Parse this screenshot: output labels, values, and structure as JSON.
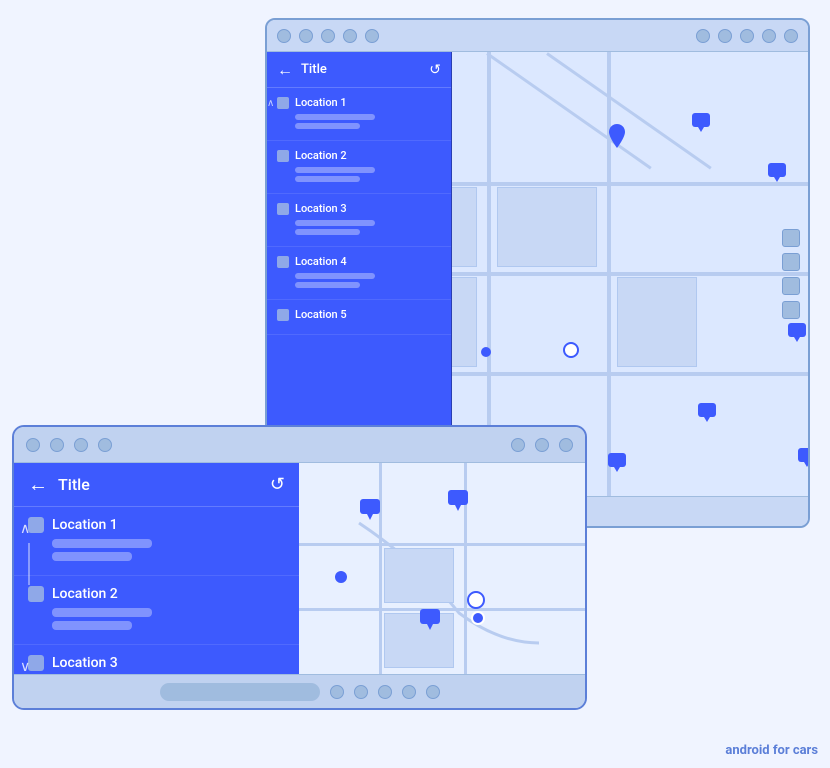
{
  "backScreen": {
    "title": "Title",
    "locations": [
      {
        "name": "Location 1",
        "bars": [
          100,
          65
        ]
      },
      {
        "name": "Location 2",
        "bars": [
          90,
          72
        ]
      },
      {
        "name": "Location 3",
        "bars": [
          85,
          60
        ]
      },
      {
        "name": "Location 4",
        "bars": [
          78,
          55
        ]
      },
      {
        "name": "Location 5",
        "bars": [
          70,
          50
        ]
      }
    ],
    "expandedItem": 0
  },
  "frontScreen": {
    "title": "Title",
    "locations": [
      {
        "name": "Location 1",
        "bars": [
          160,
          100
        ],
        "expanded": true
      },
      {
        "name": "Location 2",
        "bars": [
          160,
          100
        ],
        "expanded": false
      },
      {
        "name": "Location 3",
        "bars": [
          160,
          100
        ],
        "expanded": false
      }
    ]
  },
  "watermark": {
    "prefix": "android",
    "suffix": " for cars"
  },
  "icons": {
    "back": "←",
    "refresh": "↺",
    "chevronUp": "∧",
    "chevronDown": "∨"
  }
}
